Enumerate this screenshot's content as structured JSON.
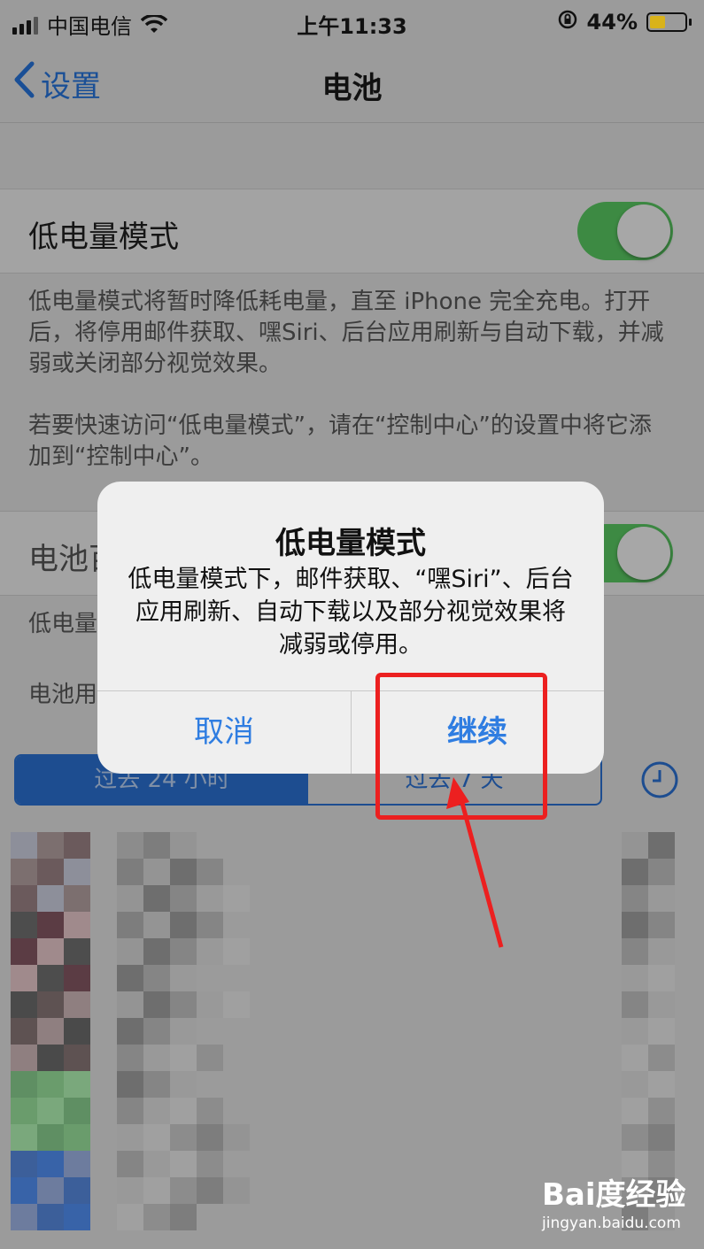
{
  "status_bar": {
    "carrier": "中国电信",
    "time": "上午11:33",
    "battery_percent": "44%",
    "battery_level": 0.44,
    "battery_color": "#d9b31a",
    "icons": [
      "signal-icon",
      "wifi-icon",
      "orientation-lock-icon",
      "battery-icon"
    ]
  },
  "nav": {
    "back_label": "设置",
    "title": "电池"
  },
  "low_power": {
    "label": "低电量模式",
    "toggle_on": true,
    "description": "低电量模式将暂时降低耗电量，直至 iPhone 完全充电。打开后，将停用邮件获取、嘿Siri、后台应用刷新与自动下载，并减弱或关闭部分视觉效果。\n\n若要快速访问“低电量模式”，请在“控制中心”的设置中将它添加到“控制中心”。"
  },
  "battery_pct_row": {
    "label_partial": "电池百",
    "toggle_on": true
  },
  "partial_lines": {
    "line1": "低电量",
    "line2": "电池用"
  },
  "segments": {
    "left": "过去 24 小时",
    "right": "过去 7 天",
    "selected": "left"
  },
  "dialog": {
    "title": "低电量模式",
    "message": "低电量模式下，邮件获取、“嘿Siri”、后台应用刷新、自动下载以及部分视觉效果将减弱或停用。",
    "cancel": "取消",
    "continue": "继续"
  },
  "colors": {
    "accent": "#2f7de1",
    "toggle_green": "#3d8a43",
    "annotation_red": "#ec2020"
  },
  "watermark": {
    "logo": "Bai度经验",
    "url": "jingyan.baidu.com"
  }
}
